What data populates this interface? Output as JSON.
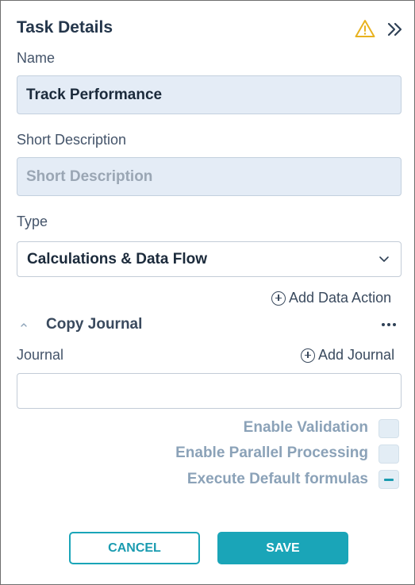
{
  "header": {
    "title": "Task Details",
    "icons": [
      "warning-icon",
      "double-chevron-right-icon"
    ],
    "warning_color": "#e8b21f"
  },
  "form": {
    "name_label": "Name",
    "name_value": "Track Performance",
    "short_description_label": "Short Description",
    "short_description_placeholder": "Short Description",
    "type_label": "Type",
    "type_value": "Calculations & Data Flow"
  },
  "actions": {
    "add_data_action": "Add Data Action"
  },
  "section": {
    "title": "Copy Journal",
    "journal_label": "Journal",
    "add_journal": "Add Journal",
    "journal_value": ""
  },
  "options": [
    {
      "label": "Enable Validation",
      "state": "unchecked"
    },
    {
      "label": "Enable Parallel Processing",
      "state": "unchecked"
    },
    {
      "label": "Execute Default formulas",
      "state": "indeterminate"
    }
  ],
  "footer": {
    "cancel_label": "CANCEL",
    "save_label": "SAVE",
    "accent_color": "#1aa5b8"
  }
}
